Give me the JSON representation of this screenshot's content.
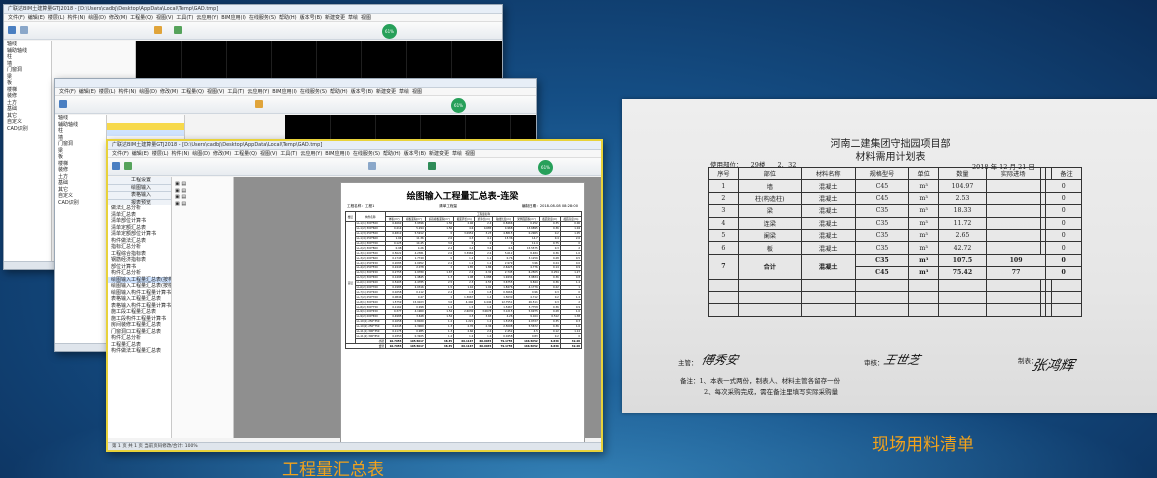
{
  "software": {
    "menu_items": [
      "文件(F)",
      "编辑(E)",
      "楼层(L)",
      "构件(N)",
      "绘图(D)",
      "修改(M)",
      "工程量(Q)",
      "视图(V)",
      "工具(T)",
      "云应用(Y)",
      "BIM应用(I)",
      "在线服务(S)",
      "帮助(H)",
      "版本号(B)",
      "新建变更",
      "草绘",
      "视图"
    ],
    "toolbar_tabs": [
      "汇总计算",
      "云汇总",
      "汇总选中图元",
      "查看计算式",
      "查看工程量",
      "查看钢筋量",
      "钢筋三维",
      "编辑钢筋",
      "锁定",
      "解锁"
    ],
    "badge_percent": "61%",
    "front_title": "广联达BIM土建算量GTJ2018 - [D:\\Users\\cadbj\\Desktop\\AppData\\Local\\Temp\\GAD.tmp]",
    "left_panel_items": [
      "工程设置",
      "绘图输入",
      "表格输入",
      "报表预览"
    ],
    "tree_items": [
      "做法汇总分析",
      "清单汇总表",
      "清单部位计算书",
      "清单定额汇总表",
      "清单定额部位计算书",
      "构件做法汇总表",
      "指标汇总分析",
      "工程综合指标表",
      "钢筋经济指标表",
      "部位计算书",
      "构件汇总分析",
      "绘图输入工程量汇总表(按构件)",
      "绘图输入工程量汇总表(按楼层)",
      "绘图输入构件工程量计算书",
      "表格输入工程量汇总表",
      "表格输入构件工程量计算书",
      "施工段工程量汇总表",
      "施工段构件工程量计算书",
      "房间装修工程量汇总表",
      "门窗洞口工程量汇总表",
      "构件汇总分析",
      "工程量汇总表",
      "构件做法工程量汇总表"
    ],
    "back_tree_items": [
      "轴线",
      "辅助轴线",
      "柱",
      "墙",
      "门窗洞",
      "梁",
      "板",
      "楼梯",
      "装修",
      "土方",
      "基础",
      "其它",
      "自定义",
      "CAD识别"
    ],
    "status_text": "第 1 页   共 1 页   当前页码修改/合计: 100%",
    "report": {
      "title": "绘图输入工程量汇总表-连梁",
      "project_label": "工程名称：工程1",
      "info_label": "清单工程量",
      "date_label": "编制日期：2018-08-08 08:28:00",
      "floor_label": "楼层",
      "name_label": "构件名称",
      "header_group": "工程量名称",
      "columns": [
        "体积(m³)",
        "模板面积(m²)",
        "超高模板面积(m²)",
        "截面周长(m)",
        "梁净长(m)",
        "轴线长度(m)",
        "梁侧面面积(m²)",
        "截面宽度(m)",
        "截面高度(m)"
      ],
      "floor_name": "首层",
      "rows": [
        [
          "LL-1(1) 300*500",
          "0.4662",
          "3.9396",
          "1.56",
          "2.46",
          "2.4",
          "0.8466",
          "0.252",
          "0.35",
          "0.06"
        ],
        [
          "LL-1(2) 300*600",
          "0.414",
          "5.294",
          "1.56",
          "4.6",
          "4.685",
          "4.968",
          "13.6895",
          "0.36",
          "1.04"
        ],
        [
          "LL-1(3) 250*500",
          "0.4812",
          "5.5912",
          "0",
          "3.0952",
          "3.23",
          "4.8815",
          "0.2965",
          "0.2",
          "1.05"
        ],
        [
          "LL-1(4) 250*600",
          "1.04",
          "11.36",
          "2.6",
          "4.3",
          "4.1",
          "13.36",
          "14.7",
          "0.4",
          "2.6"
        ],
        [
          "LL-2(1) 300*700",
          "0.125",
          "14.45",
          "3.6",
          "0",
          "0",
          "0",
          "11.4",
          "0.75",
          "0"
        ],
        [
          "LL-2(2) 300*800",
          "0.98",
          "4.26",
          "2.4",
          "4.4",
          "3.6",
          "4.6",
          "15.5575",
          "0.3",
          "2"
        ],
        [
          "LL-3(1) 200*500",
          "0.5622",
          "4.2381",
          "2.6",
          "3.3966",
          "2.6",
          "5.612",
          "8.484",
          "0.36",
          "1.6"
        ],
        [
          "LL-3(2) 200*600",
          "0.1745",
          "1.7749",
          "0",
          "1.2",
          "1.1",
          "0.76",
          "3.1256",
          "0.28",
          "0.5"
        ],
        [
          "LL-4(1) 250*450",
          "0.2085",
          "2.0052",
          "2.2",
          "1.2",
          "1.2",
          "2.979",
          "3.96",
          "0.24",
          "0.6"
        ],
        [
          "LL-4(2) 250*550",
          "0.2443",
          "2.078",
          "2",
          "1.85",
          "1.86",
          "2.6425",
          "4.776",
          "0.14",
          "0.9"
        ],
        [
          "LL-5(1) 300*450",
          "0.2755",
          "2.9780",
          "1.67",
          "2.2",
          "2.32",
          "2.745",
          "6.2505",
          "0.254",
          "1.27"
        ],
        [
          "LL-5(2) 300*650",
          "0.1495",
          "1.4845",
          "1.3",
          "1.08",
          "1.088",
          "1.9434",
          "3.9834",
          "0.36",
          "0.8"
        ],
        [
          "LL-6(1) 200*400",
          "0.5405",
          "4.4785",
          "2.5",
          "2.3",
          "2.55",
          "3.6755",
          "9.844",
          "0.36",
          "1.4"
        ],
        [
          "LL-6(2) 200*700",
          "0.1985",
          "2.0316",
          "1.5",
          "1.16",
          "1.02",
          "1.8476",
          "4.1776",
          "0.22",
          "1"
        ],
        [
          "LL-7(1) 250*400",
          "0.0258",
          "0.112",
          "2.4",
          "1.5",
          "1.8",
          "0.3666",
          "0.96",
          "0.3",
          "0"
        ],
        [
          "LL-7(2) 250*700",
          "0.0846",
          "0.47",
          "2",
          "1.3667",
          "1.4",
          "1.5630",
          "4.712",
          "0.2",
          "1.4"
        ],
        [
          "LL-8(1) 300*400",
          "1.5759",
          "15.9103",
          "3.6",
          "4.446",
          "4.446",
          "12.7551",
          "26.511",
          "0.3",
          "2"
        ],
        [
          "LL-8(2) 300*750",
          "0.1162",
          "0.998",
          "1.2",
          "1.5",
          "1.6",
          "1.5467",
          "3.7758",
          "0.36",
          "0.9"
        ],
        [
          "LL-9(1) 200*450",
          "0.377",
          "4.1960",
          "1.54",
          "2.6030",
          "3.0678",
          "3.1215",
          "5.6975",
          "0.28",
          "1.6"
        ],
        [
          "LL-9(2) 200*650",
          "0.4985",
          "3.648",
          "1.54",
          "4.3",
          "3.65",
          "4.26",
          "9.164",
          "0.512",
          "1.38"
        ],
        [
          "LL-10(1) 250*350",
          "0.1658",
          "0.8020",
          "1.2",
          "1.221",
          "1.2",
          "1.5158",
          "2.0727",
          "0.35",
          "0.3"
        ],
        [
          "LL-10(2) 250*750",
          "0.2245",
          "2.3960",
          "1.3",
          "2.76",
          "2.36",
          "2.5008",
          "5.5672",
          "0.36",
          "1.6"
        ],
        [
          "LL-11(1) 300*350",
          "0.1175",
          "0.985",
          "1.3",
          "2.66",
          "2.6",
          "2.452",
          "4.5",
          "0.12",
          "1.14"
        ],
        [
          "LL-11(2) 300*850",
          "0.0353",
          "0.3925",
          "1.2",
          "1.2",
          "1.6",
          "0.0458",
          "0.83",
          "0.2",
          "0"
        ]
      ],
      "subtotal_label": "小计",
      "subtotal": [
        "10.7955",
        "105.5017",
        "48.35",
        "60.1167",
        "60.9035",
        "79.1755",
        "166.5652",
        "6.836",
        "32.28"
      ],
      "total_label": "合计",
      "total": [
        "10.7955",
        "105.5017",
        "48.35",
        "60.1167",
        "60.9035",
        "79.1755",
        "166.5652",
        "6.836",
        "32.28"
      ]
    }
  },
  "paper": {
    "title_line1": "河南二建集团守拙园项目部",
    "title_line2": "材料需用计划表",
    "unit_label": "使用部位：",
    "unit_value": "29楼",
    "unit_extra": "2、32",
    "date": "2018 年 12 月 21 日",
    "headers": [
      "序号",
      "部位",
      "材料名称",
      "规格型号",
      "单位",
      "数量",
      "实际进场",
      "",
      "",
      "备注"
    ],
    "rows": [
      [
        "1",
        "墙",
        "混凝土",
        "C45",
        "m³",
        "104.97",
        "",
        "",
        "0"
      ],
      [
        "2",
        "柱(构造柱)",
        "混凝土",
        "C45",
        "m³",
        "2.53",
        "",
        "",
        "0"
      ],
      [
        "3",
        "梁",
        "混凝土",
        "C35",
        "m³",
        "18.33",
        "",
        "",
        "0"
      ],
      [
        "4",
        "连梁",
        "混凝土",
        "C35",
        "m³",
        "11.72",
        "",
        "",
        "0"
      ],
      [
        "5",
        "阑梁",
        "混凝土",
        "C35",
        "m³",
        "2.65",
        "",
        "",
        "0"
      ],
      [
        "6",
        "板",
        "混凝土",
        "C35",
        "m³",
        "42.72",
        "",
        "",
        "0"
      ]
    ],
    "total_no": "7",
    "total_label": "合计",
    "total_material": "混凝土",
    "total_rows": [
      [
        "C35",
        "m³",
        "107.5",
        "109",
        "0"
      ],
      [
        "C45",
        "m³",
        "75.42",
        "77",
        "0"
      ]
    ],
    "footer_zhuguan": "主管：",
    "footer_shenhe": "审核：",
    "footer_zhibiao": "制表：",
    "sig1": "傅秀安",
    "sig2": "王世芝",
    "sig3": "张鸿辉",
    "note_label": "备注：",
    "note1": "1、本表一式两份，制表人、材料主管各留存一份",
    "note2": "2、每次采购完成，需在备注里填写实际采购量"
  },
  "captions": {
    "left": "工程量汇总表",
    "right": "现场用料清单"
  },
  "colors": {
    "caption": "#f2a21b",
    "accent_yellow": "#f7d94a",
    "badge_green": "#27a05a"
  }
}
